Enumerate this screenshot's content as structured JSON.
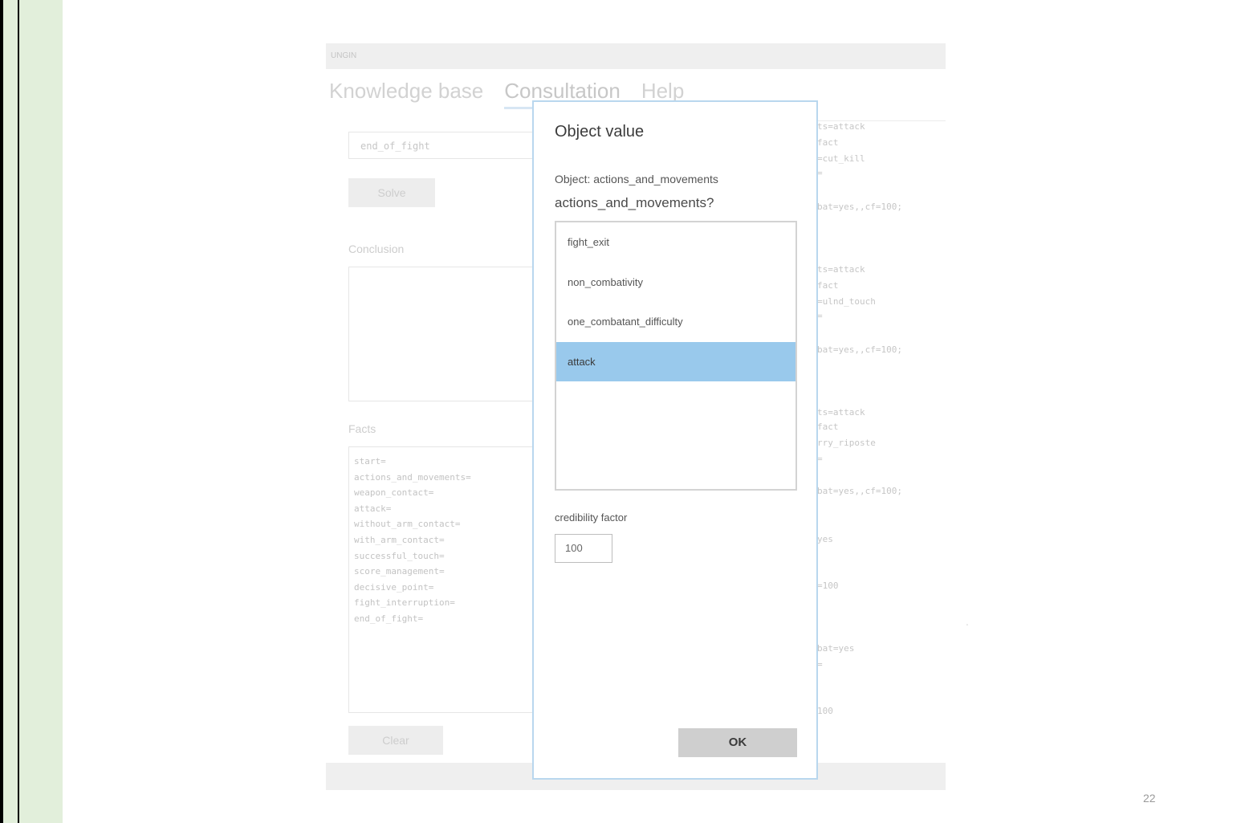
{
  "app": {
    "title": "UNGIN",
    "tabs": [
      "Knowledge base",
      "Consultation",
      "Help"
    ],
    "goal_value": "end_of_fight",
    "solve_label": "Solve",
    "conclusion_label": "Conclusion",
    "facts_label": "Facts",
    "facts_lines": [
      "start=",
      "actions_and_movements=",
      "weapon_contact=",
      "attack=",
      "without_arm_contact=",
      "with_arm_contact=",
      "successful_touch=",
      "score_management=",
      "decisive_point=",
      "fight_interruption=",
      "end_of_fight="
    ],
    "clear_label": "Clear"
  },
  "right_panel": {
    "lines": [
      "ts=attack",
      "fact",
      "=cut_kill",
      "=",
      "bat=yes,,cf=100;",
      "ts=attack",
      "fact",
      "=ulnd_touch",
      "=",
      "bat=yes,,cf=100;",
      "ts=attack",
      "fact",
      "rry_riposte",
      "=",
      "bat=yes,,cf=100;",
      "yes",
      "=100",
      "bat=yes",
      "=",
      "100"
    ]
  },
  "dialog": {
    "title": "Object value",
    "object_line": "Object: actions_and_movements",
    "question": "actions_and_movements?",
    "options": [
      "fight_exit",
      "non_combativity",
      "one_combatant_difficulty",
      "attack"
    ],
    "selected": "attack",
    "cf_label": "credibility factor",
    "cf_value": "100",
    "ok_label": "OK"
  },
  "page_number": "22",
  "tick": "'"
}
